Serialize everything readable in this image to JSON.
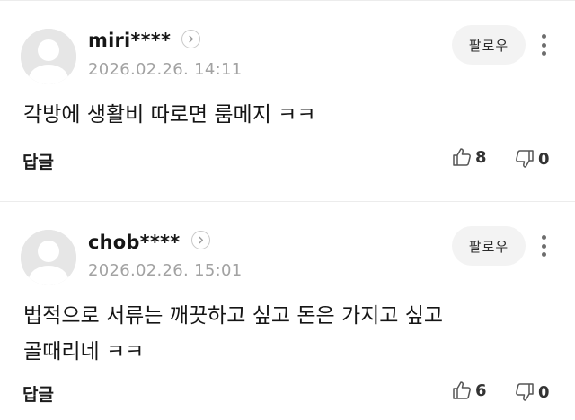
{
  "comments": [
    {
      "username": "miri****",
      "timestamp": "2026.02.26. 14:11",
      "follow_label": "팔로우",
      "body_lines": [
        "각방에 생활비 따로면 룸메지 ㅋㅋ"
      ],
      "reply_label": "답글",
      "likes": "8",
      "dislikes": "0"
    },
    {
      "username": "chob****",
      "timestamp": "2026.02.26. 15:01",
      "follow_label": "팔로우",
      "body_lines": [
        "법적으로 서류는 깨끗하고 싶고 돈은 가지고 싶고",
        "골때리네 ㅋㅋ"
      ],
      "reply_label": "답글",
      "likes": "6",
      "dislikes": "0"
    }
  ],
  "icons": {
    "avatar": "default-avatar-icon",
    "profile_link": "chevron-right-icon",
    "more": "more-vertical-icon",
    "like": "thumbs-up-icon",
    "dislike": "thumbs-down-icon"
  }
}
